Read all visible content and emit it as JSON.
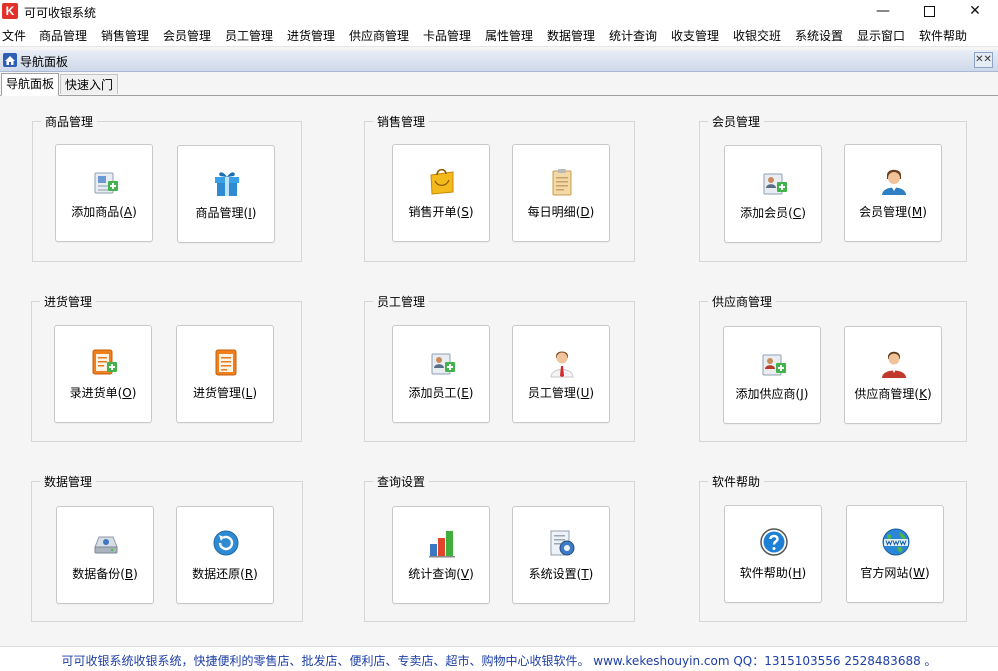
{
  "window": {
    "title": "可可收银系统",
    "logo_letter": "K"
  },
  "menu": [
    "文件",
    "商品管理",
    "销售管理",
    "会员管理",
    "员工管理",
    "进货管理",
    "供应商管理",
    "卡品管理",
    "属性管理",
    "数据管理",
    "统计查询",
    "收支管理",
    "收银交班",
    "系统设置",
    "显示窗口",
    "软件帮助"
  ],
  "panel": {
    "title": "导航面板"
  },
  "tabs": [
    "导航面板",
    "快速入门"
  ],
  "groups": [
    {
      "title": "商品管理",
      "tiles": [
        {
          "name": "添加商品",
          "key": "A",
          "icon": "add-product-icon"
        },
        {
          "name": "商品管理",
          "key": "I",
          "icon": "gift-box-icon"
        }
      ]
    },
    {
      "title": "销售管理",
      "tiles": [
        {
          "name": "销售开单",
          "key": "S",
          "icon": "shopping-bag-icon"
        },
        {
          "name": "每日明细",
          "key": "D",
          "icon": "clipboard-icon"
        }
      ]
    },
    {
      "title": "会员管理",
      "tiles": [
        {
          "name": "添加会员",
          "key": "C",
          "icon": "add-member-icon"
        },
        {
          "name": "会员管理",
          "key": "M",
          "icon": "member-icon"
        }
      ]
    },
    {
      "title": "进货管理",
      "tiles": [
        {
          "name": "录进货单",
          "key": "O",
          "icon": "add-purchase-order-icon"
        },
        {
          "name": "进货管理",
          "key": "L",
          "icon": "purchase-order-icon"
        }
      ]
    },
    {
      "title": "员工管理",
      "tiles": [
        {
          "name": "添加员工",
          "key": "E",
          "icon": "add-employee-icon"
        },
        {
          "name": "员工管理",
          "key": "U",
          "icon": "employee-icon"
        }
      ]
    },
    {
      "title": "供应商管理",
      "tiles": [
        {
          "name": "添加供应商",
          "key": "J",
          "icon": "add-supplier-icon"
        },
        {
          "name": "供应商管理",
          "key": "K",
          "icon": "supplier-icon"
        }
      ]
    },
    {
      "title": "数据管理",
      "tiles": [
        {
          "name": "数据备份",
          "key": "B",
          "icon": "backup-drive-icon"
        },
        {
          "name": "数据还原",
          "key": "R",
          "icon": "restore-icon"
        }
      ]
    },
    {
      "title": "查询设置",
      "tiles": [
        {
          "name": "统计查询",
          "key": "V",
          "icon": "bar-chart-icon"
        },
        {
          "name": "系统设置",
          "key": "T",
          "icon": "settings-document-icon"
        }
      ]
    },
    {
      "title": "软件帮助",
      "tiles": [
        {
          "name": "软件帮助",
          "key": "H",
          "icon": "help-icon"
        },
        {
          "name": "官方网站",
          "key": "W",
          "icon": "globe-www-icon"
        }
      ]
    }
  ],
  "status": "可可收银系统收银系统，快捷便利的零售店、批发店、便利店、专卖店、超市、购物中心收银软件。 www.kekeshouyin.com   QQ：1315103556 2528483688 。",
  "colors": {
    "status_text": "#1c3ea6",
    "logo": "#e0322a"
  }
}
